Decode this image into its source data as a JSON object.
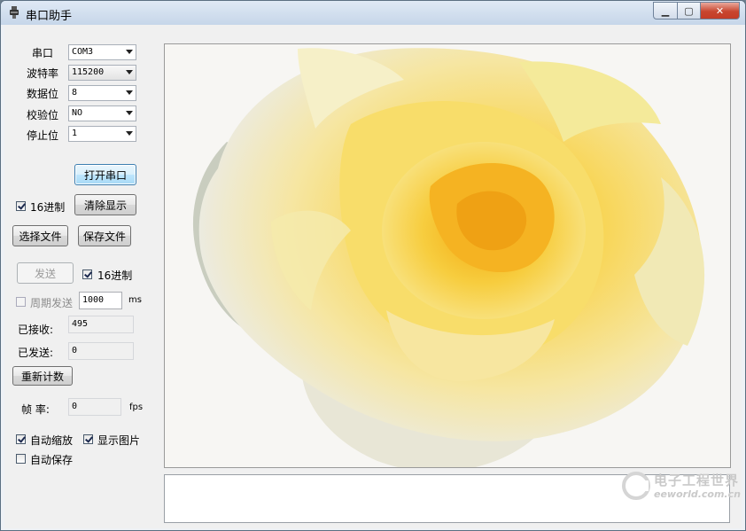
{
  "window": {
    "title": "串口助手",
    "min_icon": "minimize-icon",
    "max_icon": "maximize-icon",
    "close_icon": "close-icon"
  },
  "serial": {
    "port_label": "串口",
    "port_value": "COM3",
    "baud_label": "波特率",
    "baud_value": "115200",
    "databits_label": "数据位",
    "databits_value": "8",
    "parity_label": "校验位",
    "parity_value": "NO",
    "stopbits_label": "停止位",
    "stopbits_value": "1"
  },
  "controls": {
    "open_port": "打开串口",
    "hex_receive_label": "16进制",
    "hex_receive_checked": true,
    "clear_display": "清除显示",
    "select_file": "选择文件",
    "save_file": "保存文件",
    "send": "发送",
    "hex_send_label": "16进制",
    "hex_send_checked": true,
    "periodic_send_label": "周期发送",
    "periodic_send_checked": false,
    "period_value": "1000",
    "period_unit": "ms",
    "received_label": "已接收:",
    "received_value": "495",
    "sent_label": "已发送:",
    "sent_value": "0",
    "reset_count": "重新计数",
    "fps_label": "帧 率:",
    "fps_value": "0",
    "fps_unit": "fps",
    "auto_zoom_label": "自动缩放",
    "auto_zoom_checked": true,
    "show_image_label": "显示图片",
    "show_image_checked": true,
    "auto_save_label": "自动保存",
    "auto_save_checked": false
  },
  "display": {
    "image_subject": "yellow-rose"
  },
  "watermark": {
    "name": "电子工程世界",
    "url": "eeworld.com.cn"
  },
  "colors": {
    "titlebar": "#c6d6e9",
    "close": "#c8462f",
    "focus_button": "#bee6fd"
  }
}
